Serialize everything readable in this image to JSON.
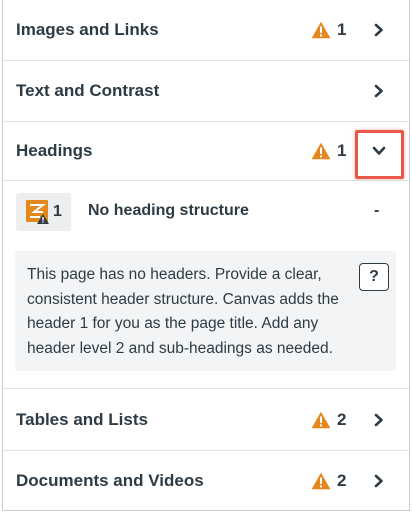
{
  "sections": [
    {
      "title": "Images and Links",
      "count": "1"
    },
    {
      "title": "Text and Contrast",
      "count": ""
    },
    {
      "title": "Headings",
      "count": "1"
    },
    {
      "title": "Tables and Lists",
      "count": "2"
    },
    {
      "title": "Documents and Videos",
      "count": "2"
    }
  ],
  "icons": {
    "warning": "warning-triangle-icon",
    "chevron_right": "chevron-right-icon",
    "chevron_down": "chevron-down-icon",
    "heading_issue": "heading-issue-icon",
    "help": "help-icon"
  },
  "colors": {
    "warning": "#e4871d",
    "highlight": "#e8584a",
    "text": "#2d3b45"
  },
  "issue": {
    "count": "1",
    "title": "No heading structure",
    "status": "-",
    "description": "This page has no headers. Provide a clear, consistent header structure. Canvas adds the header 1 for you as the page title. Add any header level 2 and sub-headings as needed.",
    "help_label": "?"
  }
}
